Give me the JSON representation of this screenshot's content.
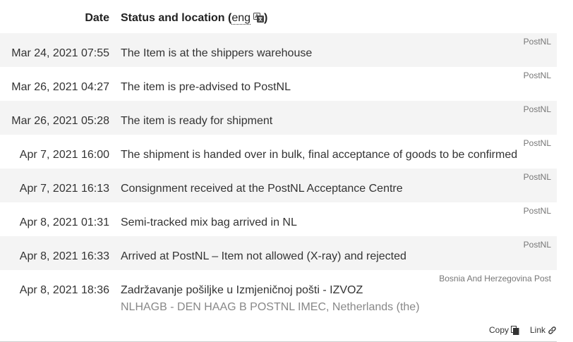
{
  "header": {
    "date_label": "Date",
    "status_label_prefix": "Status and location (",
    "lang": "eng",
    "status_label_suffix": ")"
  },
  "events": [
    {
      "date": "Mar 24, 2021 07:55",
      "status": "The Item is at the shippers warehouse",
      "carrier": "PostNL"
    },
    {
      "date": "Mar 26, 2021 04:27",
      "status": "The item is pre-advised to PostNL",
      "carrier": "PostNL"
    },
    {
      "date": "Mar 26, 2021 05:28",
      "status": "The item is ready for shipment",
      "carrier": "PostNL"
    },
    {
      "date": "Apr 7, 2021 16:00",
      "status": "The shipment is handed over in bulk, final acceptance of goods to be confirmed",
      "carrier": "PostNL"
    },
    {
      "date": "Apr 7, 2021 16:13",
      "status": "Consignment received at the PostNL Acceptance Centre",
      "carrier": "PostNL"
    },
    {
      "date": "Apr 8, 2021 01:31",
      "status": "Semi-tracked mix bag arrived in NL",
      "carrier": "PostNL"
    },
    {
      "date": "Apr 8, 2021 16:33",
      "status": "Arrived at PostNL – Item not allowed (X-ray) and rejected",
      "carrier": "PostNL"
    },
    {
      "date": "Apr 8, 2021 18:36",
      "status": "Zadržavanje pošiljke u Izmjeničnoj pošti - IZVOZ",
      "carrier": "Bosnia And Herzegovina Post",
      "location": "NLHAGB - DEN HAAG B POSTNL IMEC, Netherlands (the)"
    }
  ],
  "footer": {
    "copy_label": "Copy",
    "link_label": "Link"
  },
  "icons": {
    "translate": "translate-icon",
    "copy": "copy-icon",
    "link": "link-icon"
  }
}
